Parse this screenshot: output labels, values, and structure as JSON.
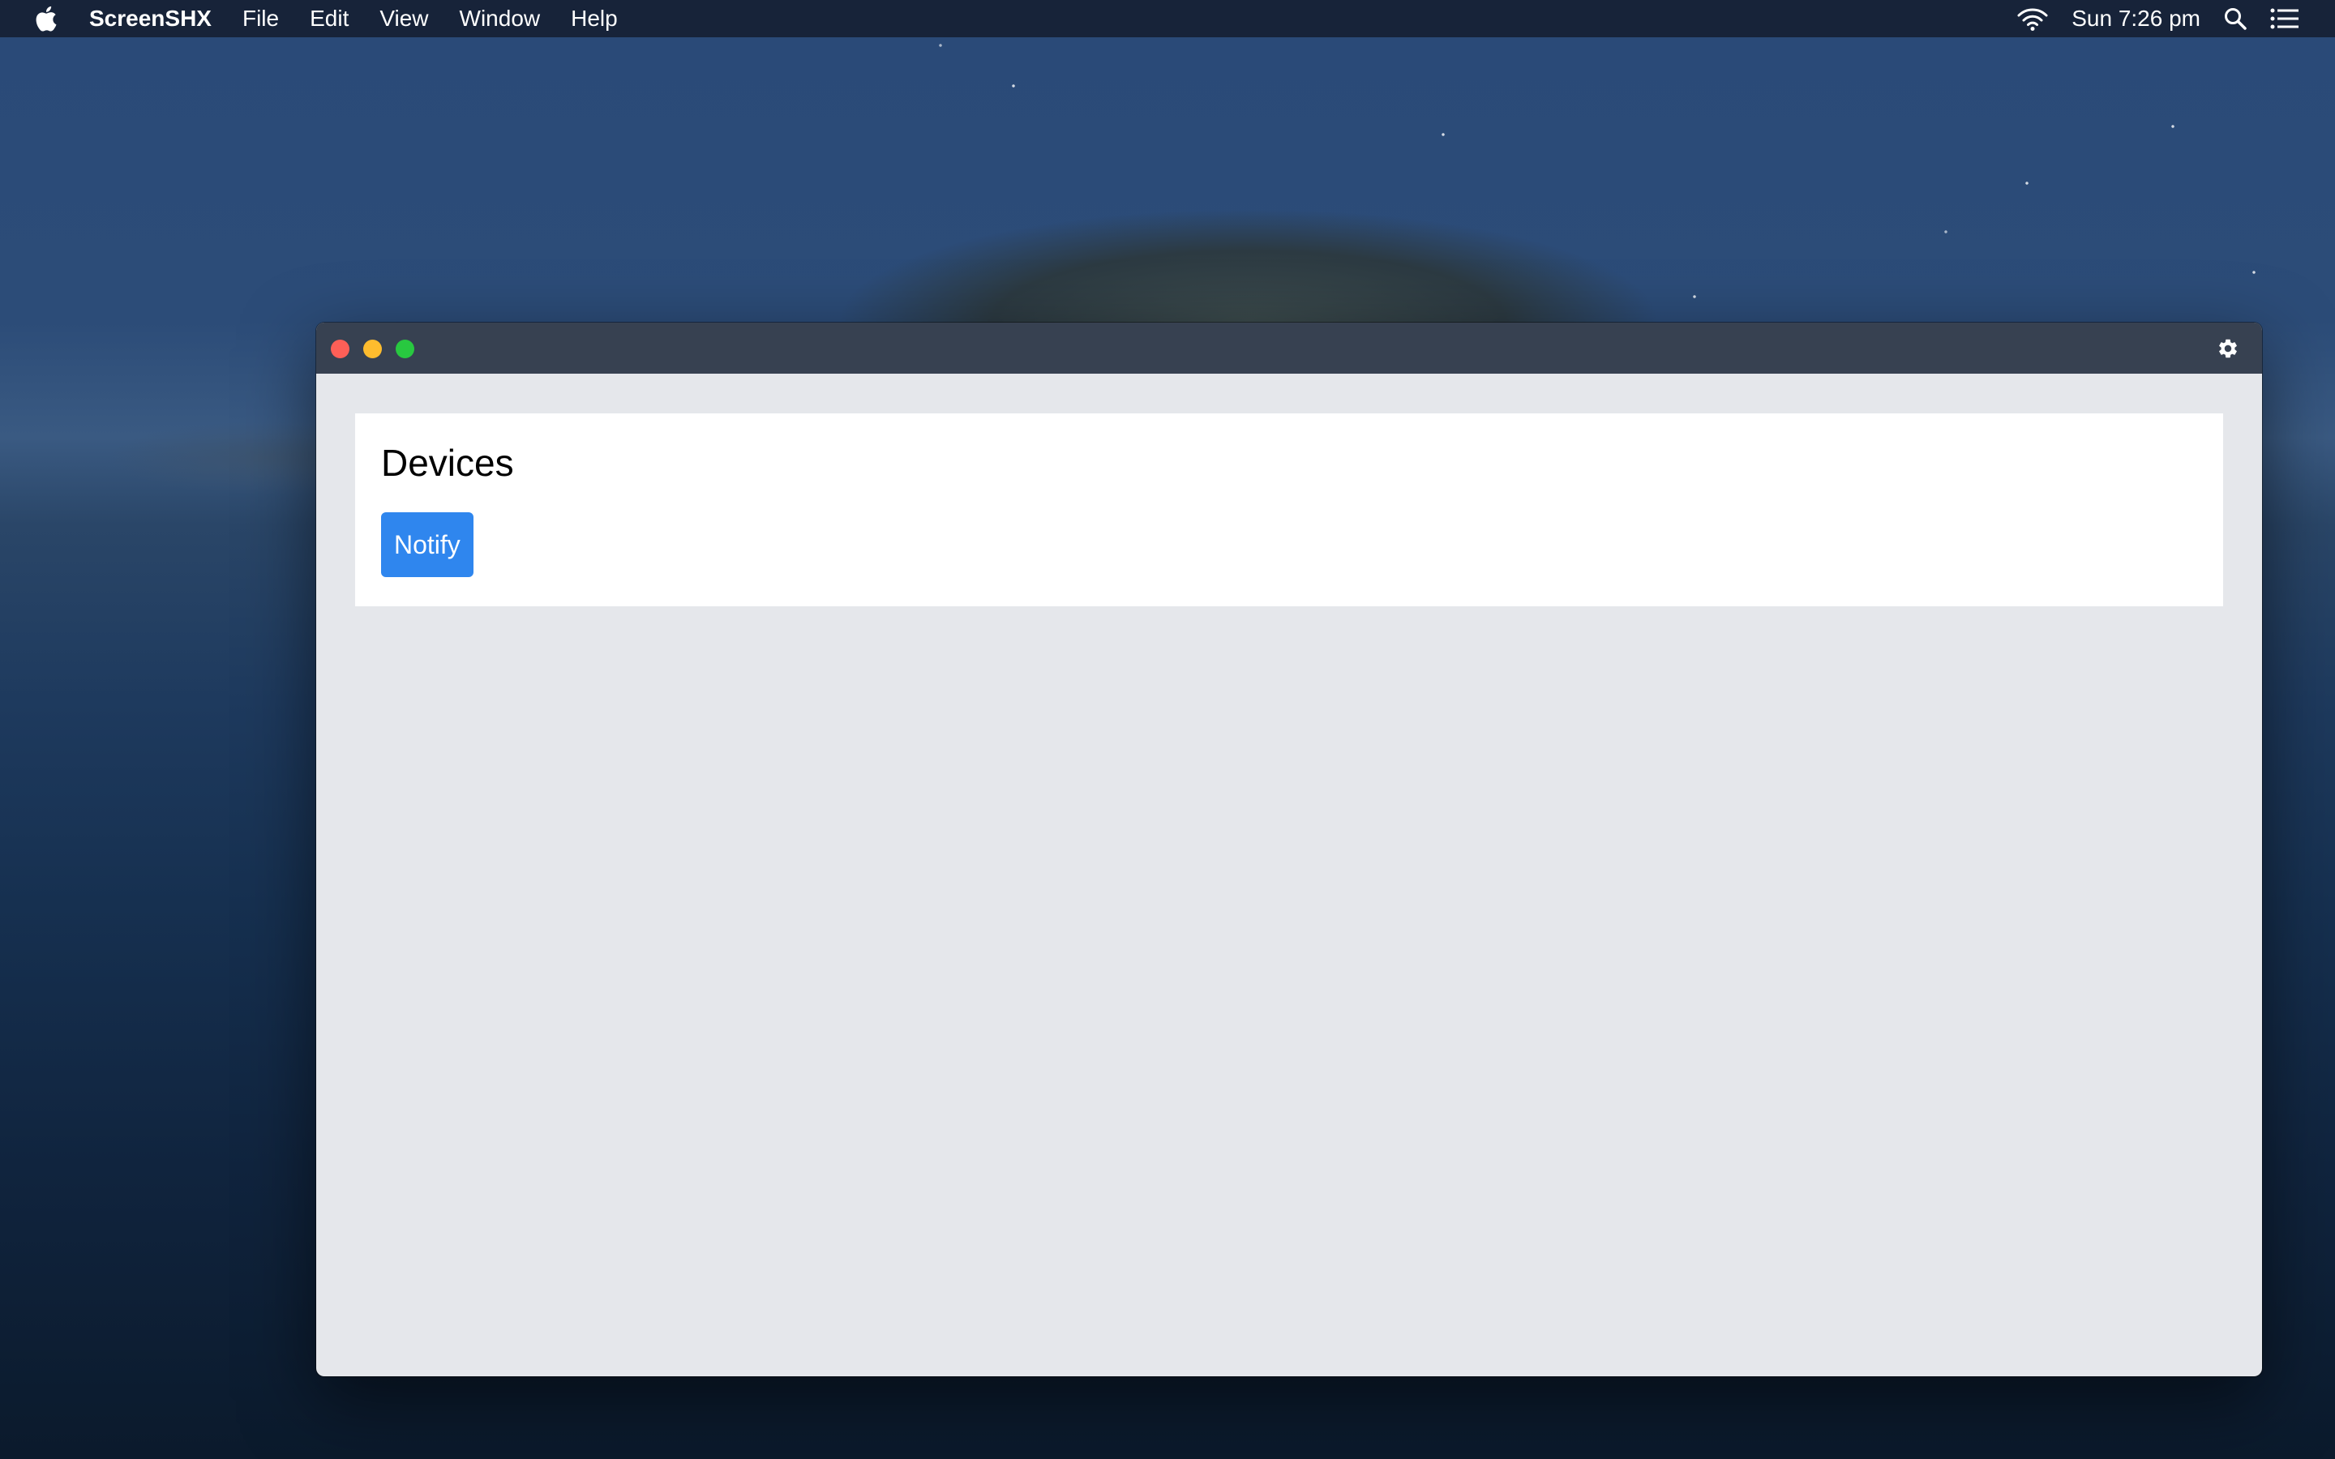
{
  "menubar": {
    "app_name": "ScreenSHX",
    "items": [
      "File",
      "Edit",
      "View",
      "Window",
      "Help"
    ],
    "clock": "Sun 7:26 pm"
  },
  "window": {
    "card": {
      "title": "Devices",
      "notify_label": "Notify"
    }
  },
  "colors": {
    "titlebar": "#374151",
    "window_bg": "#e5e7eb",
    "button": "#2f86ee",
    "close": "#fe5f57",
    "minimize": "#febc2e",
    "maximize": "#28c840"
  },
  "icons": [
    "apple-icon",
    "wifi-icon",
    "search-icon",
    "list-icon",
    "gear-icon"
  ]
}
